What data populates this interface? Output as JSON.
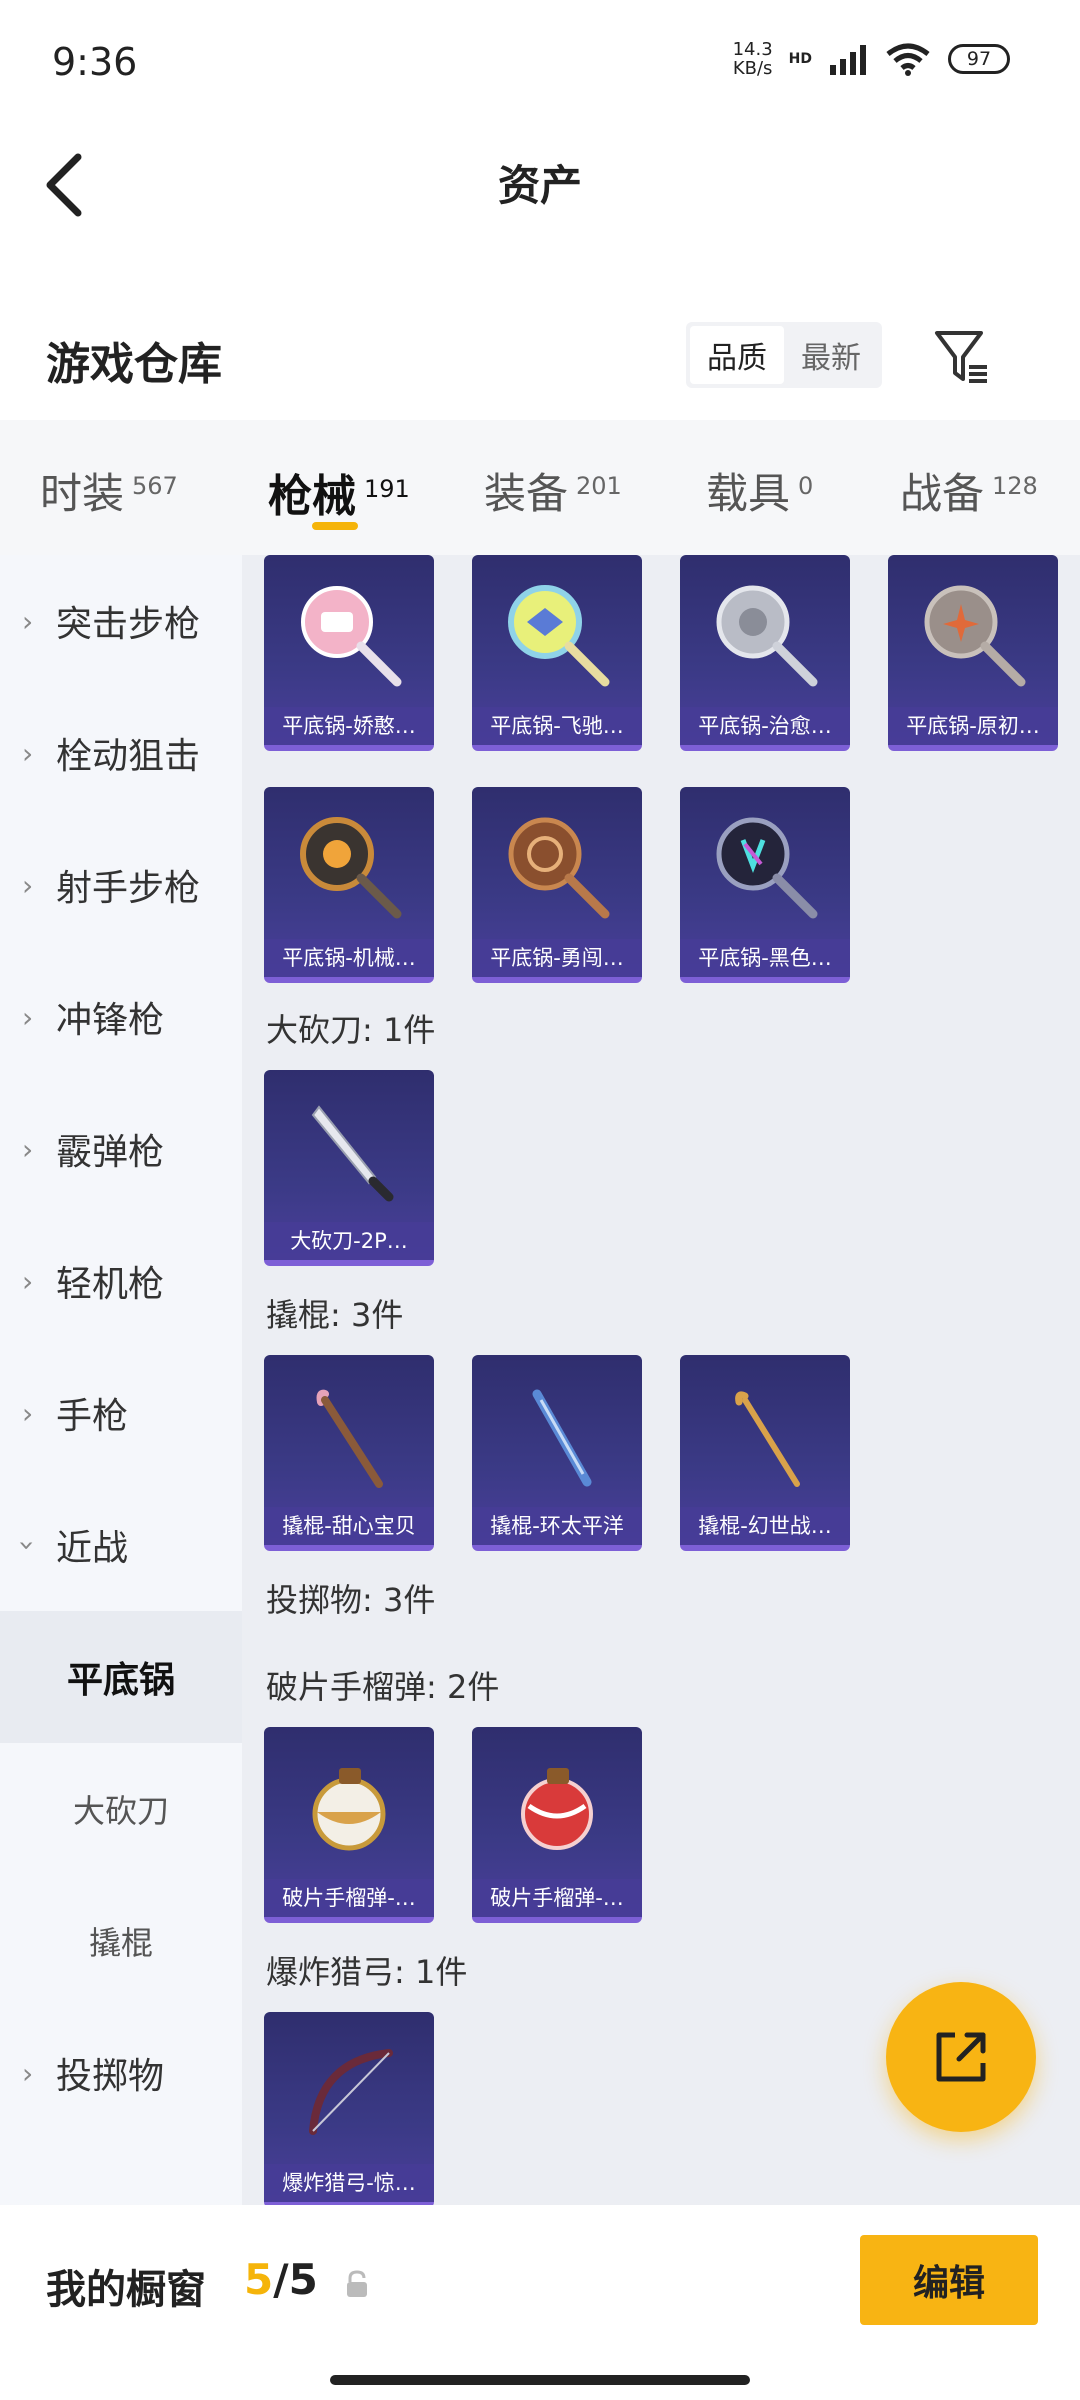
{
  "status_bar": {
    "time": "9:36",
    "net_speed_value": "14.3",
    "net_speed_unit": "KB/s",
    "hd": "HD",
    "wifi_sub": "7",
    "battery": "97"
  },
  "nav": {
    "title": "资产"
  },
  "warehouse": {
    "title": "游戏仓库",
    "sort_options": [
      "品质",
      "最新"
    ],
    "sort_selected": "品质"
  },
  "tabs": [
    {
      "label": "时装",
      "count": "567"
    },
    {
      "label": "枪械",
      "count": "191",
      "active": true
    },
    {
      "label": "装备",
      "count": "201"
    },
    {
      "label": "载具",
      "count": "0"
    },
    {
      "label": "战备",
      "count": "128"
    }
  ],
  "sidebar": {
    "items": [
      {
        "label": "突击步枪",
        "expanded": false
      },
      {
        "label": "栓动狙击",
        "expanded": false
      },
      {
        "label": "射手步枪",
        "expanded": false
      },
      {
        "label": "冲锋枪",
        "expanded": false
      },
      {
        "label": "霰弹枪",
        "expanded": false
      },
      {
        "label": "轻机枪",
        "expanded": false
      },
      {
        "label": "手枪",
        "expanded": false
      },
      {
        "label": "近战",
        "expanded": true
      },
      {
        "label": "投掷物",
        "expanded": false
      }
    ],
    "sub_items": [
      {
        "label": "平底锅",
        "active": true
      },
      {
        "label": "大砍刀",
        "active": false
      },
      {
        "label": "撬棍",
        "active": false
      }
    ]
  },
  "content": {
    "pan_items": [
      "平底锅-娇憨…",
      "平底锅-飞驰…",
      "平底锅-治愈…",
      "平底锅-原初…",
      "平底锅-机械…",
      "平底锅-勇闯…",
      "平底锅-黑色…"
    ],
    "groups": [
      {
        "title": "大砍刀: 1件",
        "items": [
          "大砍刀-2P…"
        ]
      },
      {
        "title": "撬棍: 3件",
        "items": [
          "撬棍-甜心宝贝",
          "撬棍-环太平洋",
          "撬棍-幻世战…"
        ]
      },
      {
        "title": "投掷物: 3件",
        "items": []
      },
      {
        "title": "破片手榴弹: 2件",
        "items": [
          "破片手榴弹-…",
          "破片手榴弹-…"
        ]
      },
      {
        "title": "爆炸猎弓: 1件",
        "items": [
          "爆炸猎弓-惊…"
        ]
      }
    ]
  },
  "bottom_bar": {
    "label": "我的橱窗",
    "current": "5",
    "separator": "/",
    "total": "5",
    "edit_label": "编辑"
  },
  "colors": {
    "accent": "#f8b413",
    "card_bg": "#3b3a86",
    "card_border": "#7d5fd6"
  }
}
